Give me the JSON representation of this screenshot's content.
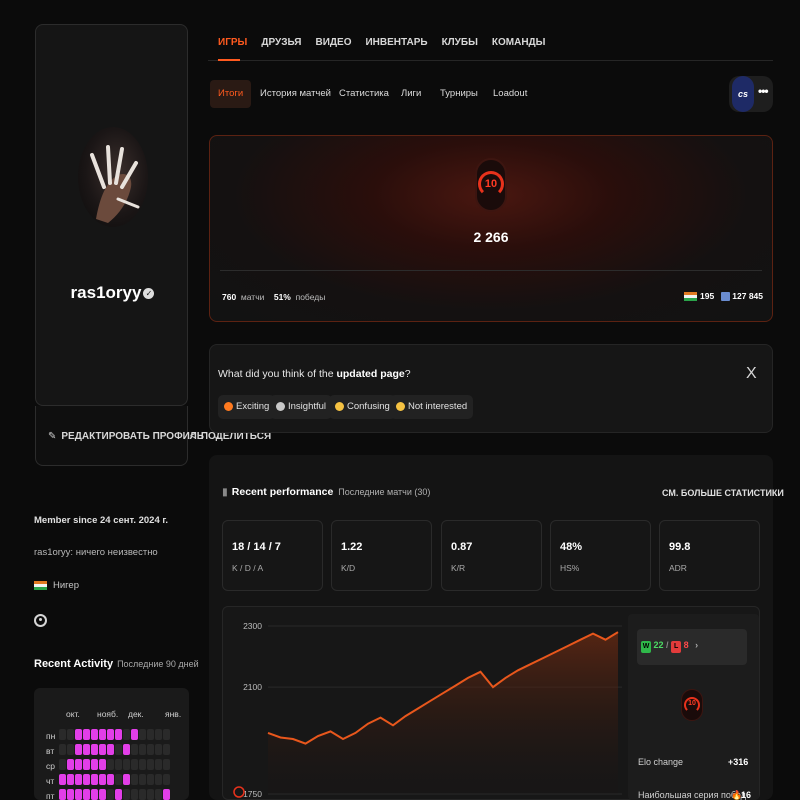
{
  "profile": {
    "username": "ras1oryy",
    "edit_label": "РЕДАКТИРОВАТЬ ПРОФИЛЬ",
    "share_label": "ПОДЕЛИТЬСЯ",
    "member_since": "Member since 24 сент. 2024 г.",
    "bio": "ras1oryy: ничего неизвестно",
    "country": "Нигер"
  },
  "activity": {
    "title": "Recent Activity",
    "subtitle": "Последние 90 дней",
    "months": [
      "окт.",
      "нояб.",
      "дек.",
      "янв."
    ],
    "days": [
      "пн",
      "вт",
      "ср",
      "чт",
      "пт"
    ],
    "active_color": "#e23ee8",
    "inactive_color": "#2a2a2a",
    "grid": [
      [
        0,
        0,
        1,
        1,
        1,
        1,
        1,
        1,
        0,
        1,
        0,
        0,
        0,
        0
      ],
      [
        0,
        0,
        1,
        1,
        1,
        1,
        1,
        0,
        1,
        0,
        0,
        0,
        0,
        0
      ],
      [
        0,
        1,
        1,
        1,
        1,
        1,
        0,
        0,
        0,
        0,
        0,
        0,
        0,
        0
      ],
      [
        1,
        1,
        1,
        1,
        1,
        1,
        1,
        0,
        1,
        0,
        0,
        0,
        0,
        0
      ],
      [
        1,
        1,
        1,
        1,
        1,
        1,
        0,
        1,
        0,
        0,
        0,
        0,
        0,
        1
      ]
    ]
  },
  "top_nav": {
    "items": [
      "ИГРЫ",
      "ДРУЗЬЯ",
      "ВИДЕО",
      "ИНВЕНТАРЬ",
      "КЛУБЫ",
      "КОМАНДЫ"
    ],
    "active_index": 0
  },
  "sub_tabs": {
    "items": [
      "Итоги",
      "История матчей",
      "Статистика",
      "Лиги",
      "Турниры",
      "Loadout"
    ],
    "active_index": 0,
    "game_label": "cs",
    "more_label": "•••"
  },
  "elo": {
    "level": "10",
    "value": "2 266",
    "matches_count": "760",
    "matches_label": "матчи",
    "wins_pct": "51%",
    "wins_label": "победы",
    "country_rank": "195",
    "global_rank": "127 845"
  },
  "feedback": {
    "question_prefix": "What did you think of the ",
    "question_bold": "updated page",
    "question_suffix": "?",
    "close": "X",
    "options": [
      "Exciting",
      "Insightful",
      "Confusing",
      "Not interested"
    ]
  },
  "performance": {
    "title": "Recent performance",
    "subtitle": "Последние матчи (30)",
    "see_more": "СМ. БОЛЬШЕ СТАТИСТИКИ",
    "stats": [
      {
        "value": "18 / 14 / 7",
        "label": "K / D / A"
      },
      {
        "value": "1.22",
        "label": "K/D"
      },
      {
        "value": "0.87",
        "label": "K/R"
      },
      {
        "value": "48%",
        "label": "HS%"
      },
      {
        "value": "99.8",
        "label": "ADR"
      }
    ],
    "wins": "22",
    "losses": "8",
    "w_letter": "W",
    "l_letter": "L",
    "level": "10",
    "elo_change_label": "Elo change",
    "elo_change_value": "+316",
    "streak_label": "Наибольшая серия побед",
    "streak_value": "16"
  },
  "chart_data": {
    "type": "area",
    "y_ticks": [
      "2300",
      "2100",
      "1750"
    ],
    "ylim": [
      1750,
      2300
    ],
    "line_color": "#e8571c",
    "values": [
      1950,
      1935,
      1930,
      1915,
      1940,
      1955,
      1930,
      1950,
      1980,
      2000,
      1975,
      2005,
      2030,
      2055,
      2080,
      2105,
      2130,
      2150,
      2100,
      2130,
      2155,
      2175,
      2195,
      2215,
      2235,
      2255,
      2275,
      2255,
      2280
    ]
  }
}
